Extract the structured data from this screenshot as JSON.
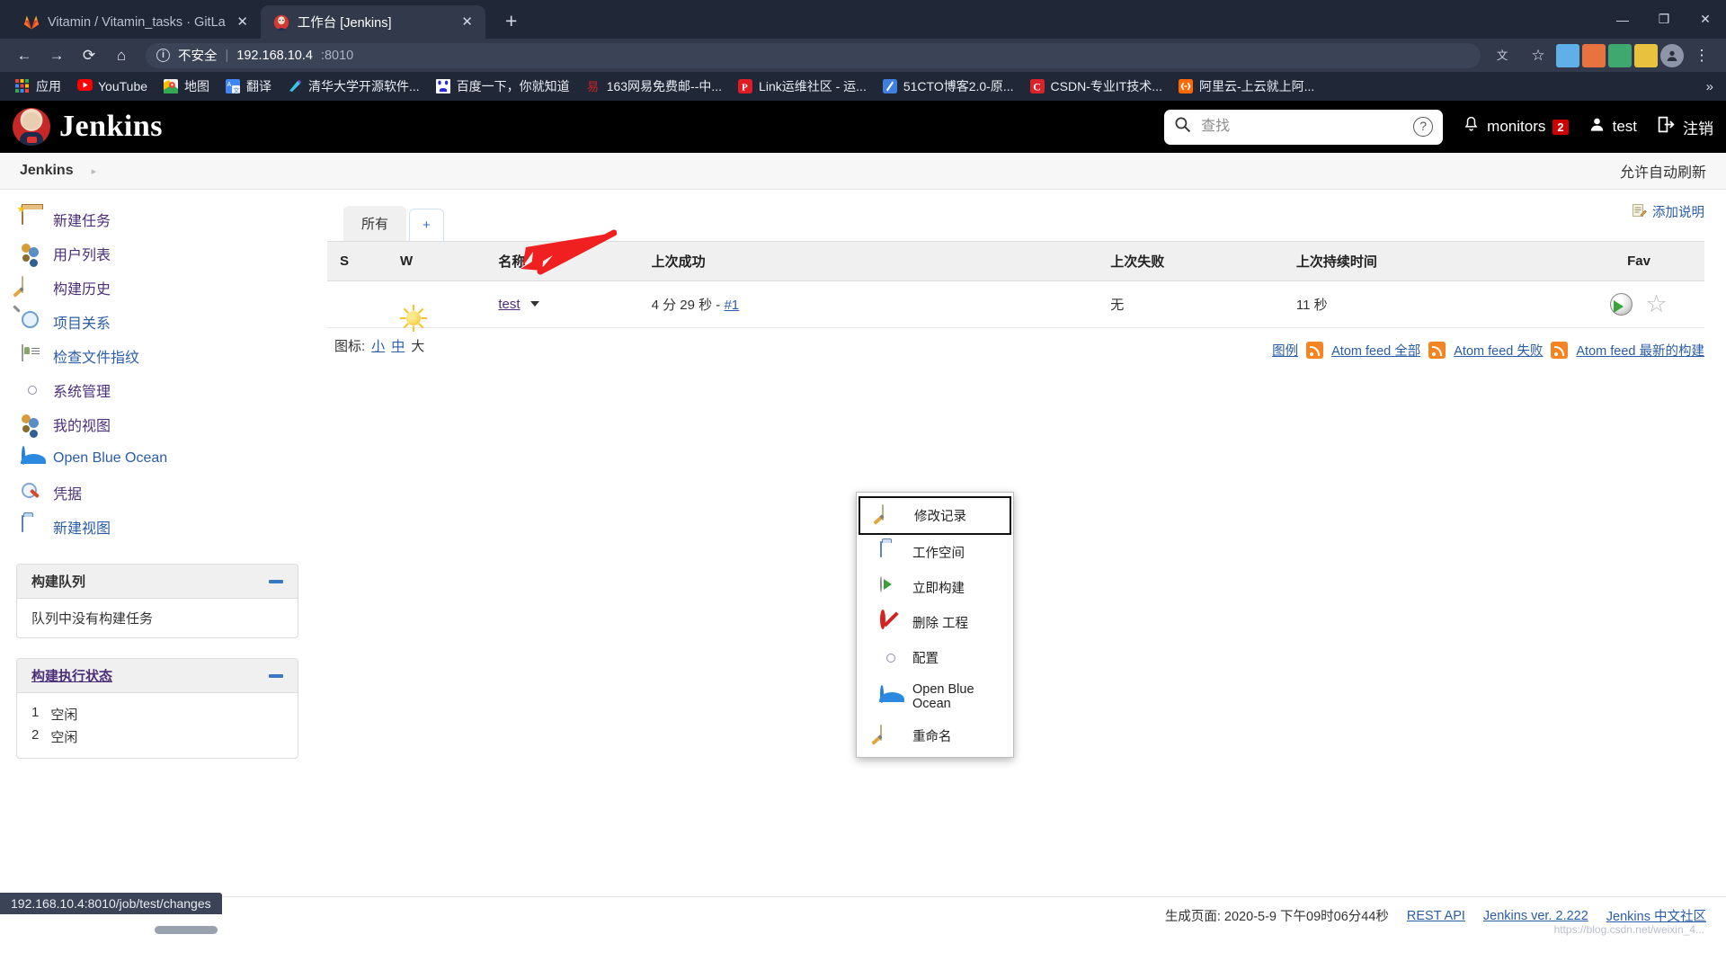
{
  "browser": {
    "tabs": [
      {
        "title": "Vitamin / Vitamin_tasks · GitLa",
        "favicon": "gitlab-icon",
        "active": false
      },
      {
        "title": "工作台 [Jenkins]",
        "favicon": "jenkins-icon",
        "active": true
      }
    ],
    "new_tab_label": "+",
    "window_buttons": {
      "minimize": "—",
      "maximize": "❐",
      "close": "✕"
    },
    "nav": {
      "back": "←",
      "forward": "→",
      "reload": "⟳",
      "home": "⌂"
    },
    "omnibox": {
      "security_label": "不安全",
      "separator": "|",
      "host": "192.168.10.4",
      "port": ":8010",
      "info_icon": "info-circle-icon"
    },
    "bookmarks": [
      {
        "label": "应用",
        "icon": "apps-grid-icon"
      },
      {
        "label": "YouTube",
        "icon": "youtube-icon"
      },
      {
        "label": "地图",
        "icon": "google-maps-icon"
      },
      {
        "label": "翻译",
        "icon": "google-translate-icon"
      },
      {
        "label": "清华大学开源软件...",
        "icon": "tuna-icon"
      },
      {
        "label": "百度一下，你就知道",
        "icon": "baidu-icon"
      },
      {
        "label": "163网易免费邮--中...",
        "icon": "netease-mail-icon"
      },
      {
        "label": "Link运维社区 - 运...",
        "icon": "link-ops-icon"
      },
      {
        "label": "51CTO博客2.0-原...",
        "icon": "51cto-icon"
      },
      {
        "label": "CSDN-专业IT技术...",
        "icon": "csdn-icon"
      },
      {
        "label": "阿里云-上云就上阿...",
        "icon": "aliyun-icon"
      }
    ],
    "bookmarks_overflow": "»"
  },
  "jenkins_header": {
    "title": "Jenkins",
    "search": {
      "placeholder": "查找",
      "value": "",
      "icon": "search-icon",
      "help_icon": "help-circle-icon"
    },
    "monitors": {
      "label": "monitors",
      "count": "2",
      "icon": "bell-icon"
    },
    "user": {
      "label": "test",
      "icon": "person-icon"
    },
    "logout": {
      "label": "注销",
      "icon": "logout-icon"
    }
  },
  "breadcrumb": {
    "root": "Jenkins",
    "arrow": "▸",
    "auto_refresh": "允许自动刷新"
  },
  "sidebar": {
    "items": [
      {
        "label": "新建任务",
        "icon": "new-job-icon",
        "visited": true
      },
      {
        "label": "用户列表",
        "icon": "users-icon",
        "visited": true
      },
      {
        "label": "构建历史",
        "icon": "build-history-icon",
        "visited": true
      },
      {
        "label": "项目关系",
        "icon": "project-relationship-icon",
        "visited": false
      },
      {
        "label": "检查文件指纹",
        "icon": "fingerprint-icon",
        "visited": false
      },
      {
        "label": "系统管理",
        "icon": "gear-icon",
        "visited": true
      },
      {
        "label": "我的视图",
        "icon": "my-views-icon",
        "visited": true
      },
      {
        "label": "Open Blue Ocean",
        "icon": "blue-ocean-icon",
        "visited": false
      },
      {
        "label": "凭据",
        "icon": "credentials-key-icon",
        "visited": true
      },
      {
        "label": "新建视图",
        "icon": "new-view-folder-icon",
        "visited": false
      }
    ],
    "build_queue": {
      "title": "构建队列",
      "empty_text": "队列中没有构建任务",
      "minimize_icon": "minimize-icon"
    },
    "build_executor": {
      "title": "构建执行状态",
      "minimize_icon": "minimize-icon",
      "executors": [
        {
          "num": "1",
          "status": "空闲"
        },
        {
          "num": "2",
          "status": "空闲"
        }
      ]
    }
  },
  "main": {
    "add_description": {
      "label": "添加说明",
      "icon": "edit-description-icon"
    },
    "tabs": [
      {
        "label": "所有",
        "active": true
      },
      {
        "label": "+",
        "active": false
      }
    ],
    "table": {
      "headers": [
        "S",
        "W",
        "名称",
        "上次成功",
        "上次失败",
        "上次持续时间",
        "Fav"
      ],
      "sort_indicator": "↓",
      "sorted_column": "名称",
      "rows": [
        {
          "status_icon": "blue-ball-icon",
          "weather_icon": "sunny-icon",
          "name": "test",
          "name_caret": "▾",
          "last_success": "4 分 29 秒",
          "last_success_sep": "-",
          "last_success_build": "#1",
          "last_failure": "无",
          "last_duration": "11 秒",
          "fav_build_icon": "schedule-build-icon",
          "fav_star_icon": "star-outline-icon"
        }
      ]
    },
    "legend": {
      "label": "图标:",
      "sizes": [
        "小",
        "中",
        "大"
      ]
    },
    "feeds": {
      "legend_link": "图例",
      "items": [
        {
          "label": "Atom feed 全部",
          "icon": "rss-icon"
        },
        {
          "label": "Atom feed 失败",
          "icon": "rss-icon"
        },
        {
          "label": "Atom feed 最新的构建",
          "icon": "rss-icon"
        }
      ]
    }
  },
  "context_menu": {
    "items": [
      {
        "label": "修改记录",
        "icon": "changes-note-icon",
        "selected": true
      },
      {
        "label": "工作空间",
        "icon": "workspace-folder-icon",
        "selected": false
      },
      {
        "label": "立即构建",
        "icon": "build-now-clock-icon",
        "selected": false
      },
      {
        "label": "删除 工程",
        "icon": "delete-ban-icon",
        "selected": false
      },
      {
        "label": "配置",
        "icon": "configure-gear-icon",
        "selected": false
      },
      {
        "label": "Open Blue Ocean",
        "icon": "blue-ocean-icon",
        "selected": false
      },
      {
        "label": "重命名",
        "icon": "rename-note-icon",
        "selected": false
      }
    ],
    "annotation_arrow_color": "#f02020"
  },
  "footer": {
    "generated": "生成页面: 2020-5-9 下午09时06分44秒",
    "links": [
      "REST API",
      "Jenkins ver. 2.222",
      "Jenkins 中文社区"
    ],
    "watermark": "https://blog.csdn.net/weixin_4..."
  },
  "status_bar": {
    "url": "192.168.10.4:8010/job/test/changes"
  },
  "colors": {
    "chrome_bg": "#202737",
    "chrome_tab_active": "#32394b",
    "jenkins_header": "#000000",
    "link": "#2b5ca8",
    "link_visited": "#4b2f7a",
    "badge_red": "#cc0000",
    "arrow_red": "#f02020",
    "panel_head": "#f0f0f0"
  }
}
